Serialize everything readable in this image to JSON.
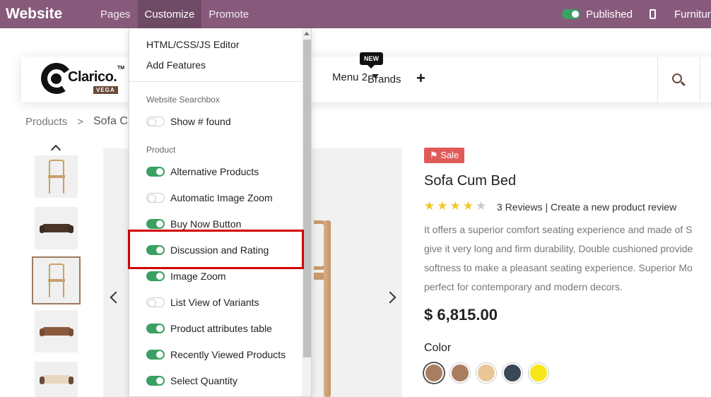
{
  "topbar": {
    "brand": "Website",
    "menu": [
      "Pages",
      "Customize",
      "Promote"
    ],
    "published_label": "Published",
    "site_label": "Furnitur"
  },
  "header": {
    "logo_text": "Clarico.",
    "logo_tm": "TM",
    "logo_badge": "VEGA",
    "nav_menu2": "Menu 2",
    "nav_brands": "Brands",
    "new_badge": "NEW",
    "plus_label": "+"
  },
  "breadcrumb": {
    "parent": "Products",
    "separator": ">",
    "current": "Sofa Cum Bed"
  },
  "product": {
    "sale_label": "Sale",
    "title": "Sofa Cum Bed",
    "rating": 4,
    "rating_max": 5,
    "reviews_text": "3 Reviews | Create a new product review",
    "description_lines": [
      "It offers a superior comfort seating experience and made of S",
      "give it very long and firm durability, Double cushioned provide",
      "softness to make a pleasant seating experience. Superior Mo",
      "perfect for contemporary and modern decors."
    ],
    "price": "$ 6,815.00",
    "color_label": "Color",
    "swatch_colors": [
      "#a97e60",
      "#a97e60",
      "#eac697",
      "#3a4855",
      "#f5e719"
    ]
  },
  "dropdown": {
    "top_items": [
      "HTML/CSS/JS Editor",
      "Add Features"
    ],
    "sections": [
      {
        "header": "Website Searchbox",
        "options": [
          {
            "label": "Show # found",
            "on": false
          }
        ]
      },
      {
        "header": "Product",
        "options": [
          {
            "label": "Alternative Products",
            "on": true
          },
          {
            "label": "Automatic Image Zoom",
            "on": false
          },
          {
            "label": "Buy Now Button",
            "on": true
          },
          {
            "label": "Discussion and Rating",
            "on": true
          },
          {
            "label": "Image Zoom",
            "on": true
          },
          {
            "label": "List View of Variants",
            "on": false
          },
          {
            "label": "Product attributes table",
            "on": true
          },
          {
            "label": "Recently Viewed Products",
            "on": true
          },
          {
            "label": "Select Quantity",
            "on": true
          }
        ]
      }
    ]
  },
  "colors": {
    "topbar_bg": "#875a7b",
    "toggle_on": "#3aa063",
    "sale_red": "#e15a5a",
    "highlight_red": "#d10000",
    "star_gold": "#f3c623"
  }
}
